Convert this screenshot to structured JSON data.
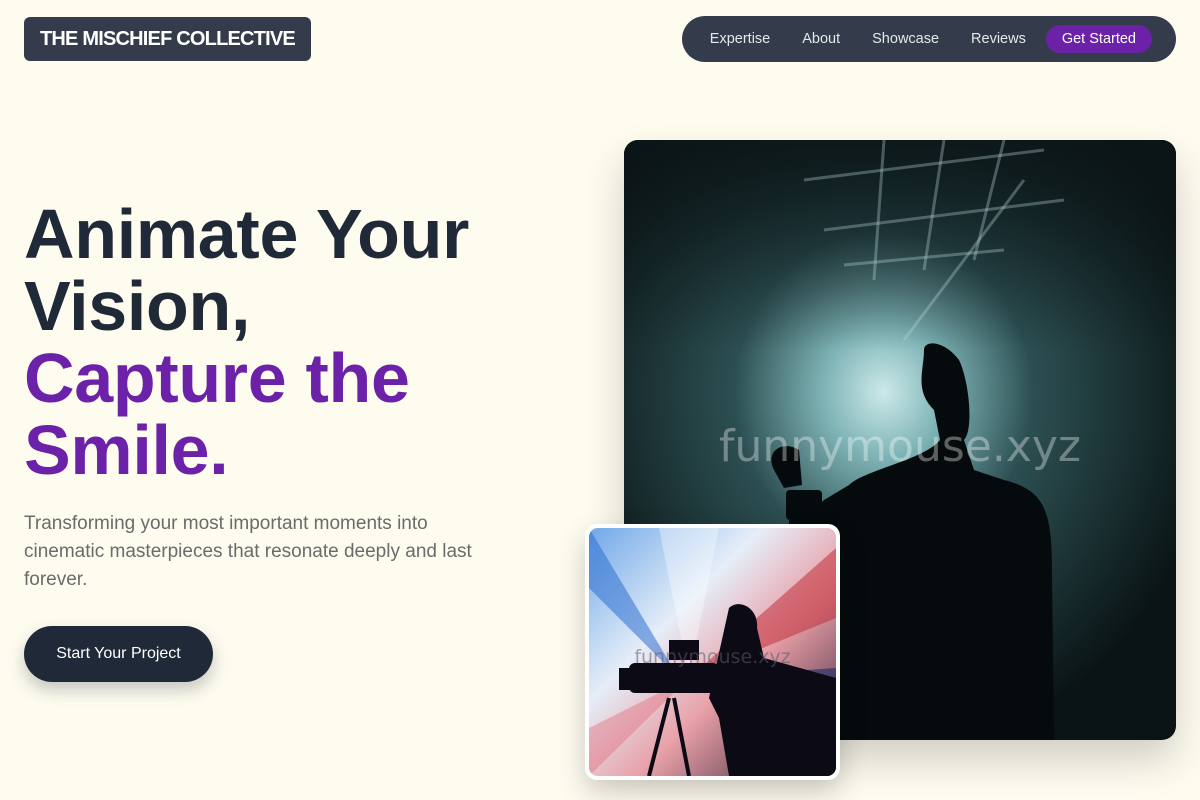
{
  "header": {
    "logo": "THE MISCHIEF COLLECTIVE",
    "nav": [
      "Expertise",
      "About",
      "Showcase",
      "Reviews"
    ],
    "cta": "Get Started"
  },
  "hero": {
    "headline_line1": "Animate Your",
    "headline_line2": "Vision,",
    "headline_line3": "Capture the",
    "headline_line4": "Smile.",
    "subtext": "Transforming your most important moments into cinematic masterpieces that resonate deeply and last forever.",
    "button": "Start Your Project"
  },
  "images": {
    "main_watermark": "funnymouse.xyz",
    "secondary_watermark": "funnymouse.xyz"
  },
  "colors": {
    "background": "#fefcef",
    "dark": "#1f2937",
    "accent": "#6b21a8",
    "nav_bg": "#343c4b"
  }
}
